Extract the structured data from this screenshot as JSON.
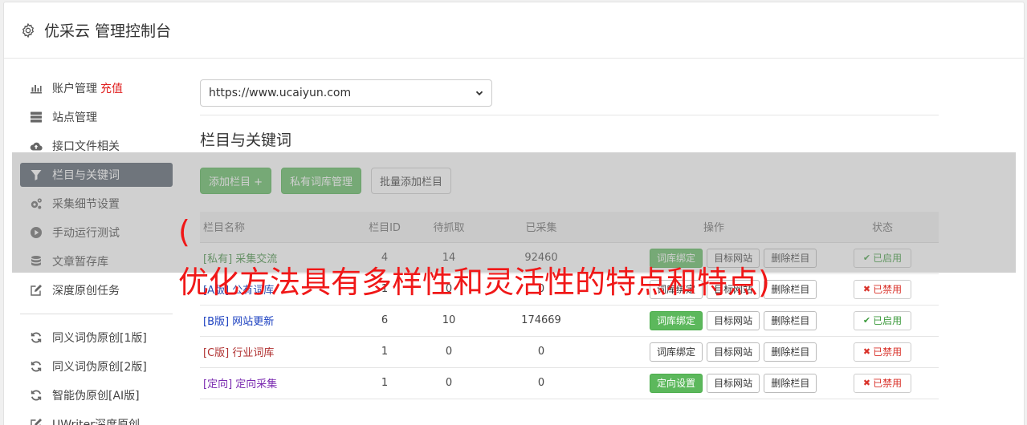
{
  "header": {
    "title": "优采云 管理控制台",
    "icon": "gear-icon"
  },
  "sidebar": {
    "items": [
      {
        "label": "账户管理",
        "extra": "充值",
        "icon": "bar-chart-icon"
      },
      {
        "label": "站点管理",
        "icon": "server-icon"
      },
      {
        "label": "接口文件相关",
        "icon": "cloud-upload-icon"
      },
      {
        "label": "栏目与关键词",
        "icon": "filter-icon",
        "active": true
      },
      {
        "label": "采集细节设置",
        "icon": "cogs-icon"
      },
      {
        "label": "手动运行测试",
        "icon": "play-circle-icon"
      },
      {
        "label": "文章暂存库",
        "icon": "database-icon"
      },
      {
        "label": "深度原创任务",
        "icon": "edit-icon"
      }
    ],
    "items2": [
      {
        "label": "同义词伪原创[1版]",
        "icon": "refresh-icon"
      },
      {
        "label": "同义词伪原创[2版]",
        "icon": "refresh-icon"
      },
      {
        "label": "智能伪原创[AI版]",
        "icon": "refresh-icon"
      },
      {
        "label": "UWriter深度原创",
        "icon": "edit-icon"
      }
    ]
  },
  "main": {
    "site_select": "https://www.ucaiyun.com",
    "section_title": "栏目与关键词",
    "buttons": {
      "add_column": "添加栏目 +",
      "private_lib": "私有词库管理",
      "batch_add": "批量添加栏目"
    },
    "table": {
      "headers": [
        "栏目名称",
        "栏目ID",
        "待抓取",
        "已采集",
        "操作",
        "状态"
      ],
      "rows": [
        {
          "tag": "[私有]",
          "name": "采集交流",
          "id": "4",
          "pending": "14",
          "collected": "92460",
          "op1": "词库绑定",
          "op1_green": true,
          "op2": "目标网站",
          "op3": "删除栏目",
          "status": "已启用",
          "status_on": true,
          "color": "#3c8a3c"
        },
        {
          "tag": "[A版]",
          "name": "公有词库",
          "id": "1",
          "pending": "0",
          "collected": "0",
          "op1": "词库绑定",
          "op1_green": false,
          "op2": "目标网站",
          "op3": "删除栏目",
          "status": "已禁用",
          "status_on": false,
          "color": "#2a4fb0"
        },
        {
          "tag": "[B版]",
          "name": "网站更新",
          "id": "6",
          "pending": "10",
          "collected": "174669",
          "op1": "词库绑定",
          "op1_green": true,
          "op2": "目标网站",
          "op3": "删除栏目",
          "status": "已启用",
          "status_on": true,
          "color": "#1a3fc0"
        },
        {
          "tag": "[C版]",
          "name": "行业词库",
          "id": "1",
          "pending": "0",
          "collected": "0",
          "op1": "词库绑定",
          "op1_green": false,
          "op2": "目标网站",
          "op3": "删除栏目",
          "status": "已禁用",
          "status_on": false,
          "color": "#b03030"
        },
        {
          "tag": "[定向]",
          "name": "定向采集",
          "id": "1",
          "pending": "0",
          "collected": "0",
          "op1": "定向设置",
          "op1_green": true,
          "op2": "目标网站",
          "op3": "删除栏目",
          "status": "已禁用",
          "status_on": false,
          "color": "#7a2ab0"
        }
      ]
    }
  },
  "overlay_text": {
    "paren": "(",
    "main": "优化方法具有多样性和灵活性的特点和特点)"
  },
  "colors": {
    "accent_green": "#5cb85c",
    "active_nav": "#4f5a66",
    "danger": "#d9332b",
    "ad_red": "#f01818"
  }
}
